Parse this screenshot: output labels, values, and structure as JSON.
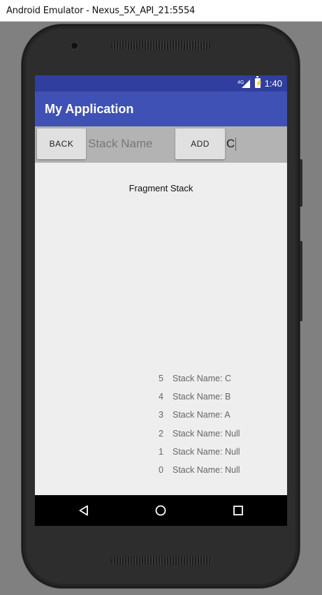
{
  "window": {
    "title": "Android Emulator - Nexus_5X_API_21:5554"
  },
  "status_bar": {
    "network": "4G",
    "time": "1:40",
    "colors": {
      "bar": "#303f9f"
    }
  },
  "app_bar": {
    "title": "My Application",
    "color": "#3f51b5"
  },
  "controls": {
    "back_label": "BACK",
    "stack_name_placeholder": "Stack Name",
    "add_label": "ADD",
    "add_input_value": "C"
  },
  "content": {
    "title": "Fragment Stack",
    "stack": [
      {
        "index": "5",
        "label": "Stack Name: C"
      },
      {
        "index": "4",
        "label": "Stack Name: B"
      },
      {
        "index": "3",
        "label": "Stack Name: A"
      },
      {
        "index": "2",
        "label": "Stack Name: Null"
      },
      {
        "index": "1",
        "label": "Stack Name: Null"
      },
      {
        "index": "0",
        "label": "Stack Name: Null"
      }
    ]
  },
  "nav_bar": {
    "icons": [
      "back-triangle-icon",
      "home-circle-icon",
      "recents-square-icon"
    ]
  }
}
